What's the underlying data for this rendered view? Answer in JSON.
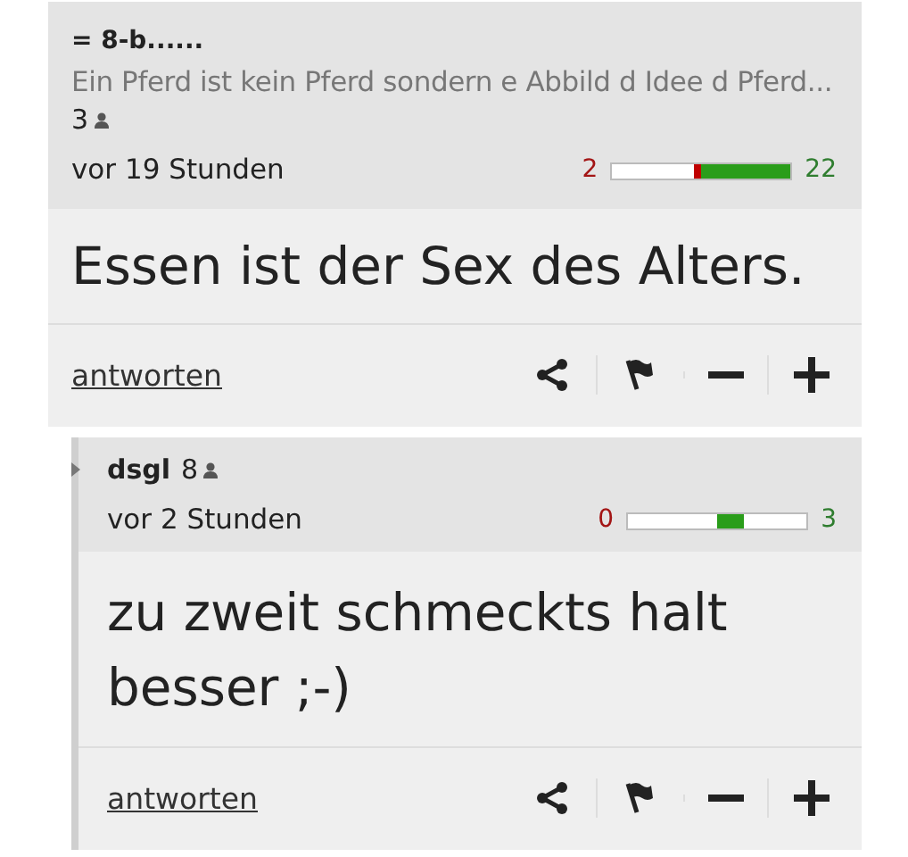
{
  "comments": [
    {
      "kind": "top",
      "author": "= 8-b......",
      "signature": "Ein Pferd ist kein Pferd sondern e Abbild d Idee d Pferd...",
      "followers": "3",
      "time": "vor 19 Stunden",
      "votes": {
        "down": {
          "count": "2",
          "level": 0.09
        },
        "up": {
          "count": "22",
          "level": 1.0
        }
      },
      "text": "Essen ist der Sex des Alters.",
      "reply": "antworten"
    },
    {
      "kind": "reply",
      "author": "dsgl",
      "followers": "8",
      "time": "vor 2 Stunden",
      "votes": {
        "down": {
          "count": "0"
        },
        "up": {
          "count": "3",
          "level": 0.3
        }
      },
      "text": "zu zweit schmeckts halt besser ;-)",
      "reply": "antworten"
    }
  ]
}
